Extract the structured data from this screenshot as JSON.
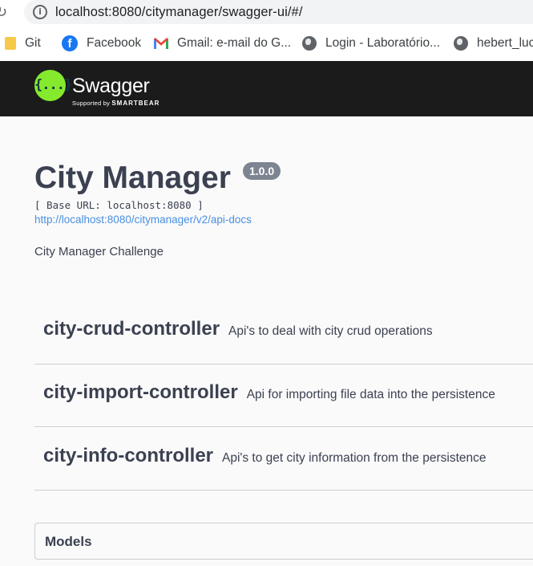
{
  "browser": {
    "url": "localhost:8080/citymanager/swagger-ui/#/",
    "bookmarks": [
      {
        "label": "Git",
        "icon": "folder-icon"
      },
      {
        "label": "Facebook",
        "icon": "facebook-icon"
      },
      {
        "label": "Gmail: e-mail do G...",
        "icon": "gmail-icon"
      },
      {
        "label": "Login - Laboratório...",
        "icon": "globe-icon"
      },
      {
        "label": "hebert_luch",
        "icon": "globe-icon"
      }
    ]
  },
  "topbar": {
    "logo_glyph": "{...}",
    "brand": "Swagger",
    "brand_sub_prefix": "Supported by",
    "brand_sub_name": "SMARTBEAR",
    "logo_color": "#85ea2d",
    "bg_color": "#1b1b1b"
  },
  "info": {
    "title": "City Manager",
    "version": "1.0.0",
    "base_url": "[ Base URL: localhost:8080 ]",
    "api_docs_link": "http://localhost:8080/citymanager/v2/api-docs",
    "description": "City Manager Challenge"
  },
  "tags": [
    {
      "name": "city-crud-controller",
      "description": "Api's to deal with city crud operations"
    },
    {
      "name": "city-import-controller",
      "description": "Api for importing file data into the persistence"
    },
    {
      "name": "city-info-controller",
      "description": "Api's to get city information from the persistence"
    }
  ],
  "models": {
    "label": "Models"
  }
}
